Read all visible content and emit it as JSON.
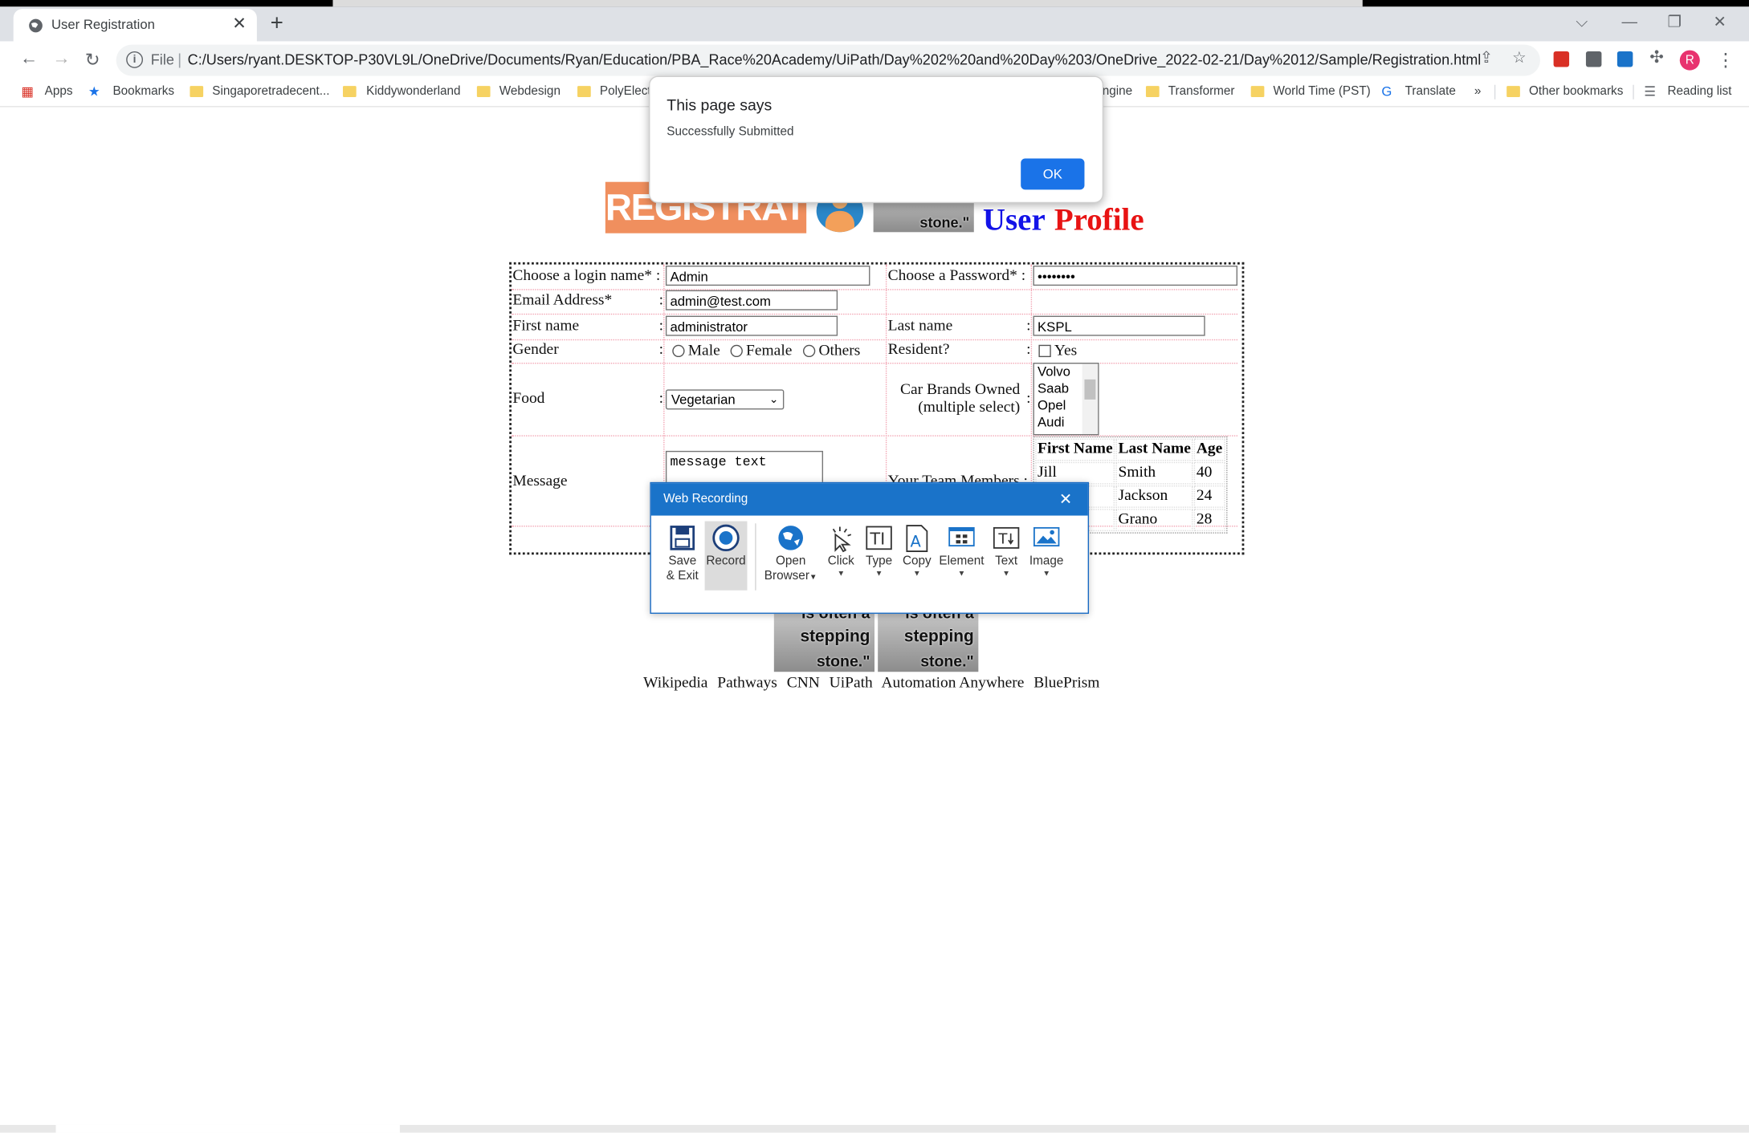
{
  "browser": {
    "tab_title": "User Registration",
    "url_scheme": "File",
    "url": "C:/Users/ryant.DESKTOP-P30VL9L/OneDrive/Documents/Ryan/Education/PBA_Race%20Academy/UiPath/Day%202%20and%20Day%203/OneDrive_2022-02-21/Day%2012/Sample/Registration.html",
    "avatar_letter": "R",
    "bookmarks": [
      "Apps",
      "Bookmarks",
      "Singaporetradecent...",
      "Kiddywonderland",
      "Webdesign",
      "PolyElectr",
      "ngine",
      "Transformer",
      "World Time (PST)",
      "Translate",
      "»",
      "Other bookmarks",
      "Reading list"
    ]
  },
  "alert": {
    "title": "This page says",
    "message": "Successfully Submitted",
    "ok_label": "OK"
  },
  "header": {
    "banner_text": "REGISTRATION",
    "image_caption": "stone.\"",
    "title_part1": "User",
    "title_part2": "Profile"
  },
  "form": {
    "login_label": "Choose a login name* :",
    "login_value": "Admin",
    "password_label": "Choose a Password* :",
    "password_value": "••••••••",
    "email_label": "Email Address*",
    "email_value": "admin@test.com",
    "firstname_label": "First name",
    "firstname_value": "administrator",
    "lastname_label": "Last name",
    "lastname_value": "KSPL",
    "gender_label": "Gender",
    "gender_options": [
      "Male",
      "Female",
      "Others"
    ],
    "resident_label": "Resident?",
    "resident_option": "Yes",
    "food_label": "Food",
    "food_value": "Vegetarian",
    "cars_label_1": "Car Brands Owned",
    "cars_label_2": "(multiple select)",
    "cars_options": [
      "Volvo",
      "Saab",
      "Opel",
      "Audi"
    ],
    "message_label": "Message",
    "message_value": "message text",
    "team_label": "Your Team Members :",
    "separator": ":",
    "team_table": {
      "headers": [
        "First Name",
        "Last Name",
        "Age"
      ],
      "rows": [
        [
          "Jill",
          "Smith",
          "40"
        ],
        [
          "",
          "Jackson",
          "24"
        ],
        [
          "",
          "Grano",
          "28"
        ]
      ]
    }
  },
  "footer_images": {
    "caption_1": "is often a",
    "caption_2": "stepping",
    "caption_3": "stone.\""
  },
  "footer_links": [
    "Wikipedia",
    "Pathways",
    "CNN",
    "UiPath",
    "Automation Anywhere",
    "BluePrism"
  ],
  "web_recording": {
    "title": "Web Recording",
    "tools": [
      {
        "label": "Save",
        "label2": "& Exit",
        "icon": "save-icon"
      },
      {
        "label": "Record",
        "label2": "",
        "icon": "record-icon"
      },
      {
        "label": "Open",
        "label2": "Browser",
        "icon": "globe-icon"
      },
      {
        "label": "Click",
        "label2": "",
        "icon": "cursor-click-icon"
      },
      {
        "label": "Type",
        "label2": "",
        "icon": "type-icon"
      },
      {
        "label": "Copy",
        "label2": "",
        "icon": "copy-icon"
      },
      {
        "label": "Element",
        "label2": "",
        "icon": "element-icon"
      },
      {
        "label": "Text",
        "label2": "",
        "icon": "text-icon"
      },
      {
        "label": "Image",
        "label2": "",
        "icon": "image-icon"
      }
    ]
  },
  "colors": {
    "accent_blue": "#1a73e8",
    "uipath_blue": "#1a73c9",
    "title_blue": "#1313e8",
    "title_red": "#e81313",
    "banner_orange": "#f08f5e"
  }
}
